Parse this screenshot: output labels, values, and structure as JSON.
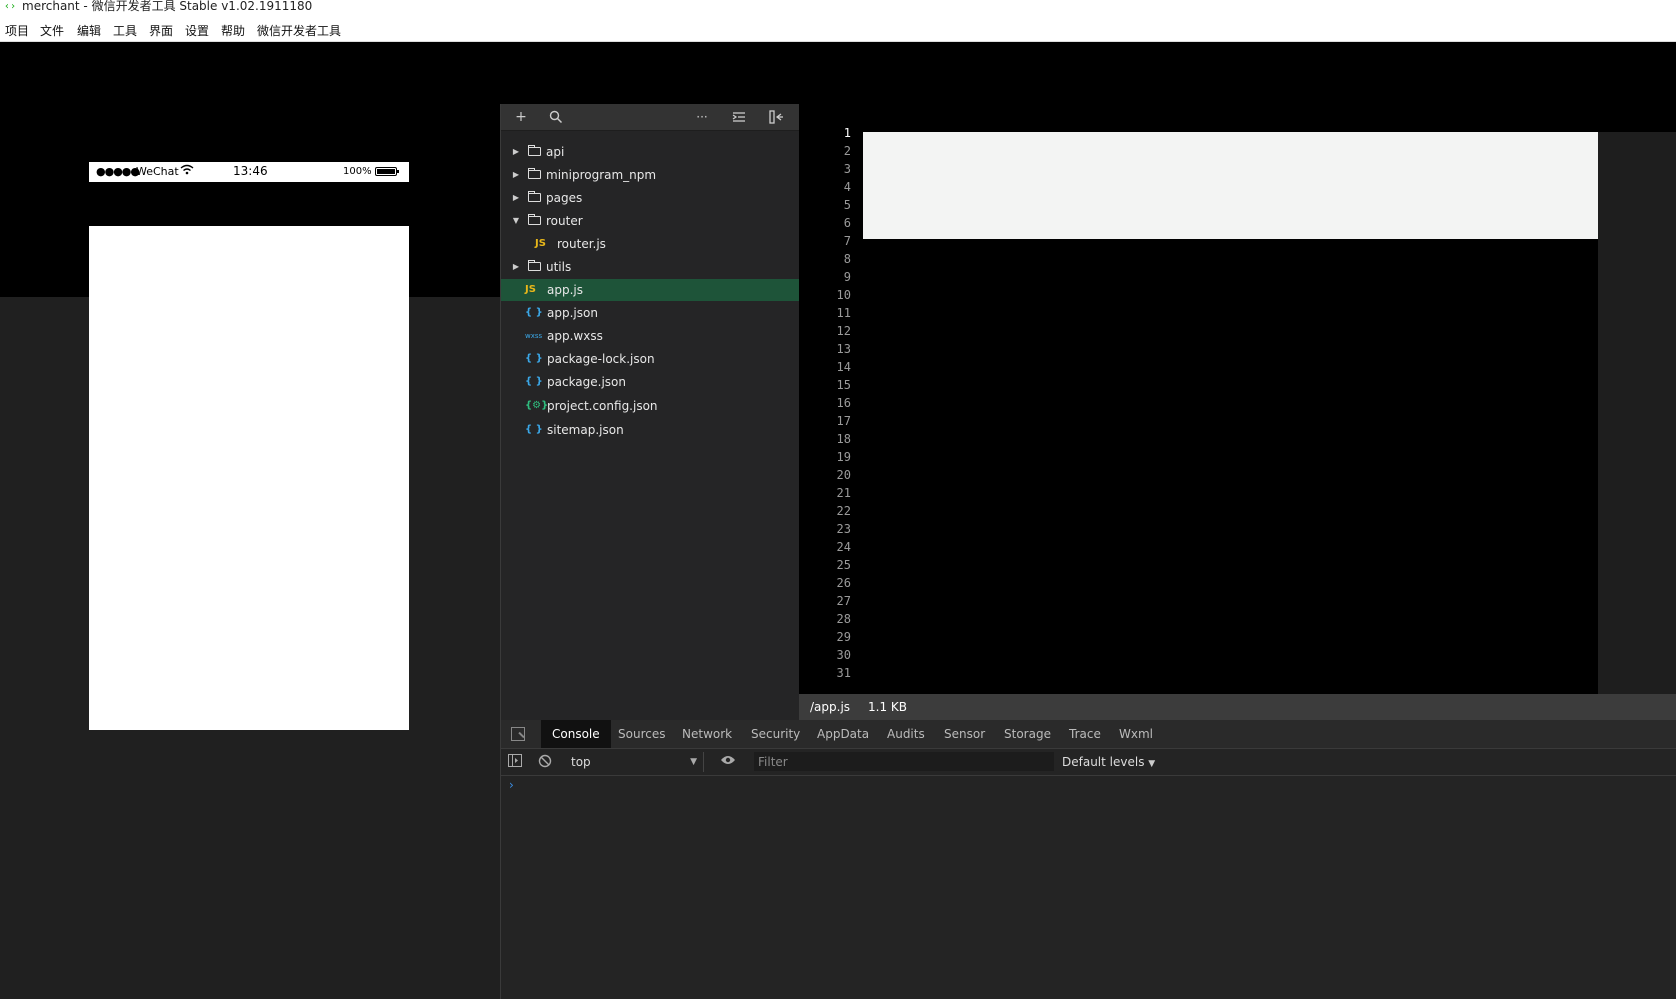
{
  "window": {
    "title": "merchant - 微信开发者工具 Stable v1.02.1911180",
    "logo_icon": "wechat-devtools-logo"
  },
  "menubar": {
    "items": [
      "项目",
      "文件",
      "编辑",
      "工具",
      "界面",
      "设置",
      "帮助",
      "微信开发者工具"
    ]
  },
  "simulator": {
    "status": {
      "signal": "●●●●●",
      "carrier": "WeChat",
      "wifi_icon": "wifi-icon",
      "time": "13:46",
      "battery": "100%"
    }
  },
  "explorer": {
    "toolbar": {
      "add": "+",
      "search_icon": "search-icon",
      "more": "···",
      "collapse_icon": "collapse-all-icon",
      "hide_icon": "hide-sidebar-icon"
    },
    "tree": [
      {
        "name": "api",
        "type": "folder",
        "expanded": false,
        "depth": 0
      },
      {
        "name": "miniprogram_npm",
        "type": "folder",
        "expanded": false,
        "depth": 0
      },
      {
        "name": "pages",
        "type": "folder",
        "expanded": false,
        "depth": 0
      },
      {
        "name": "router",
        "type": "folder",
        "expanded": true,
        "depth": 0
      },
      {
        "name": "router.js",
        "type": "js",
        "depth": 1
      },
      {
        "name": "utils",
        "type": "folder",
        "expanded": false,
        "depth": 0
      },
      {
        "name": "app.js",
        "type": "js",
        "depth": 0,
        "selected": true
      },
      {
        "name": "app.json",
        "type": "json",
        "depth": 0
      },
      {
        "name": "app.wxss",
        "type": "wxss",
        "depth": 0
      },
      {
        "name": "package-lock.json",
        "type": "json",
        "depth": 0
      },
      {
        "name": "package.json",
        "type": "json",
        "depth": 0
      },
      {
        "name": "project.config.json",
        "type": "config",
        "depth": 0
      },
      {
        "name": "sitemap.json",
        "type": "json",
        "depth": 0
      }
    ]
  },
  "editor": {
    "line_count": 31,
    "active_line": 1,
    "status": {
      "path": "/app.js",
      "size": "1.1 KB"
    }
  },
  "devtools": {
    "tabs": [
      "Console",
      "Sources",
      "Network",
      "Security",
      "AppData",
      "Audits",
      "Sensor",
      "Storage",
      "Trace",
      "Wxml"
    ],
    "active_tab": "Console",
    "context": "top",
    "filter_placeholder": "Filter",
    "levels": "Default levels",
    "prompt": "›"
  },
  "colors": {
    "selected_row": "#1e5439",
    "js_icon": "#e8b71a",
    "json_icon": "#3ba8e8",
    "config_icon": "#2fbf7f"
  }
}
